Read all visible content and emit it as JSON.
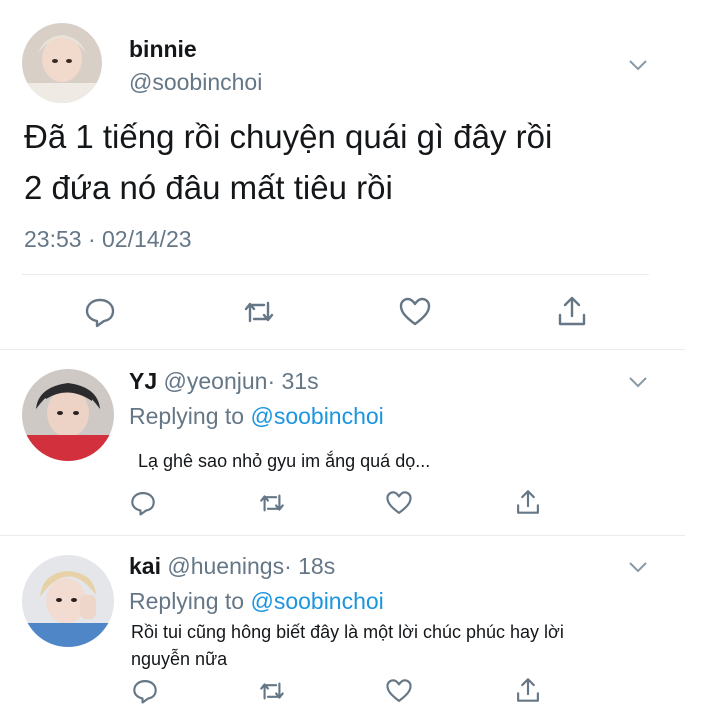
{
  "main_tweet": {
    "display_name": "binnie",
    "handle": "@soobinchoi",
    "text_line1": "Đã 1 tiếng rồi chuyện quái gì đây rồi",
    "text_line2": "2 đứa nó đâu mất tiêu rồi",
    "timestamp": "23:53 · 02/14/23"
  },
  "replies": [
    {
      "display_name": "YJ",
      "handle": "@yeonjun",
      "time": "· 31s",
      "replying_label": "Replying to",
      "replying_handle": "@soobinchoi",
      "text": "Lạ ghê sao nhỏ gyu im ắng quá dọ..."
    },
    {
      "display_name": "kai",
      "handle": "@huenings",
      "time": "· 18s",
      "replying_label": "Replying to",
      "replying_handle": "@soobinchoi",
      "text_line1": "Rồi tui cũng hông biết đây là một lời chúc phúc hay lời",
      "text_line2": "nguyễn nữa"
    }
  ],
  "icons": [
    "reply-icon",
    "retweet-icon",
    "like-icon",
    "share-icon",
    "chevron-down-icon"
  ],
  "colors": {
    "text": "#14171a",
    "secondary": "#657786",
    "link": "#1b95e0",
    "divider": "#e6ecf0"
  }
}
